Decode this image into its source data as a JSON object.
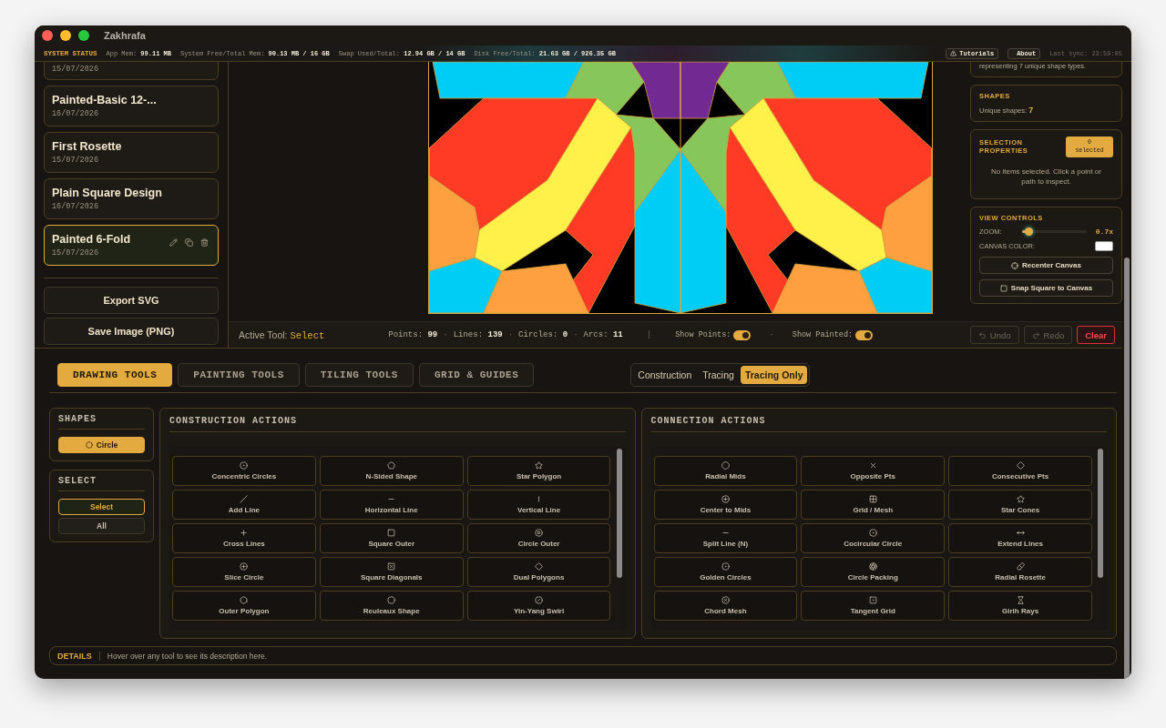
{
  "window": {
    "title": "Zakhrafa"
  },
  "status_bar": {
    "label": "SYSTEM STATUS",
    "stats": [
      {
        "label": "App Mem:",
        "value": "99.11 MB"
      },
      {
        "label": "System Free/Total Mem:",
        "value": "90.13 MB / 16 GB"
      },
      {
        "label": "Swap Used/Total:",
        "value": "12.94 GB / 14 GB"
      },
      {
        "label": "Disk Free/Total:",
        "value": "21.63 GB / 926.35 GB"
      }
    ],
    "buttons": [
      "Tutorials",
      "About"
    ],
    "last_sync": "Last sync: 23:59:05"
  },
  "projects": [
    {
      "date": "15/07/2026",
      "selected": false
    },
    {
      "name": "Painted-Basic 12-...",
      "date": "16/07/2026",
      "selected": false
    },
    {
      "name": "First Rosette",
      "date": "15/07/2026",
      "selected": false
    },
    {
      "name": "Plain Square Design",
      "date": "16/07/2026",
      "selected": false
    },
    {
      "name": "Painted 6-Fold",
      "date": "15/07/2026",
      "selected": true
    }
  ],
  "export_buttons": [
    "Export SVG",
    "Save Image (PNG)"
  ],
  "info_panel": {
    "summary": "representing 7 unique shape types.",
    "shapes": {
      "title": "SHAPES",
      "label": "Unique shapes:",
      "value": "7"
    },
    "selection": {
      "title": "SELECTION PROPERTIES",
      "badge": "0 selected",
      "message": "No items selected. Click a point or path to inspect."
    },
    "view": {
      "title": "VIEW CONTROLS",
      "zoom_label": "ZOOM:",
      "level": 0.1,
      "zoom_value": "0.7x",
      "color_label": "CANVAS COLOR:",
      "buttons": [
        "Recenter Canvas",
        "Snap Square to Canvas"
      ]
    }
  },
  "toolbar": {
    "active_label": "Active Tool:",
    "active_tool": "Select",
    "separator": "·",
    "divider": "|",
    "stats": [
      {
        "label": "Points:",
        "value": "99"
      },
      {
        "label": "Lines:",
        "value": "139"
      },
      {
        "label": "Circles:",
        "value": "0"
      },
      {
        "label": "Arcs:",
        "value": "11"
      }
    ],
    "toggles": [
      {
        "label": "Show Points:",
        "on": true
      },
      {
        "label": "Show Painted:",
        "on": true
      }
    ],
    "actions": [
      {
        "label": "Undo",
        "kind": "undo",
        "disabled": true
      },
      {
        "label": "Redo",
        "kind": "redo",
        "disabled": true
      },
      {
        "label": "Clear",
        "kind": "danger",
        "disabled": false
      }
    ]
  },
  "tabs": [
    {
      "label": "DRAWING TOOLS",
      "selected": true
    },
    {
      "label": "PAINTING TOOLS",
      "selected": false
    },
    {
      "label": "TILING TOOLS",
      "selected": false
    },
    {
      "label": "GRID & GUIDES",
      "selected": false
    }
  ],
  "modes": [
    {
      "label": "Construction",
      "selected": false
    },
    {
      "label": "Tracing",
      "selected": false
    },
    {
      "label": "Tracing Only",
      "selected": true
    }
  ],
  "shapes_panel": {
    "title": "SHAPES",
    "items": [
      {
        "label": "Circle",
        "selected": true
      }
    ]
  },
  "select_panel": {
    "title": "SELECT",
    "items": [
      {
        "label": "Select",
        "selected": true
      },
      {
        "label": "All",
        "selected": false
      }
    ]
  },
  "construction": {
    "title": "CONSTRUCTION ACTIONS",
    "tools": [
      "Concentric Circles",
      "N-Sided Shape",
      "Star Polygon",
      "Add Line",
      "Horizontal Line",
      "Vertical Line",
      "Cross Lines",
      "Square Outer",
      "Circle Outer",
      "Slice Circle",
      "Square Diagonals",
      "Dual Polygons",
      "Outer Polygon",
      "Reuleaux Shape",
      "Yin-Yang Swirl"
    ]
  },
  "connection": {
    "title": "CONNECTION ACTIONS",
    "tools": [
      "Radial Mids",
      "Opposite Pts",
      "Consecutive Pts",
      "Center to Mids",
      "Grid / Mesh",
      "Star Cones",
      "Split Line (N)",
      "Cocircular Circle",
      "Extend Lines",
      "Golden Circles",
      "Circle Packing",
      "Radial Rosette",
      "Chord Mesh",
      "Tangent Grid",
      "Girih Rays"
    ]
  },
  "details": {
    "label": "DETAILS",
    "text": "Hover over any tool to see its description here."
  }
}
